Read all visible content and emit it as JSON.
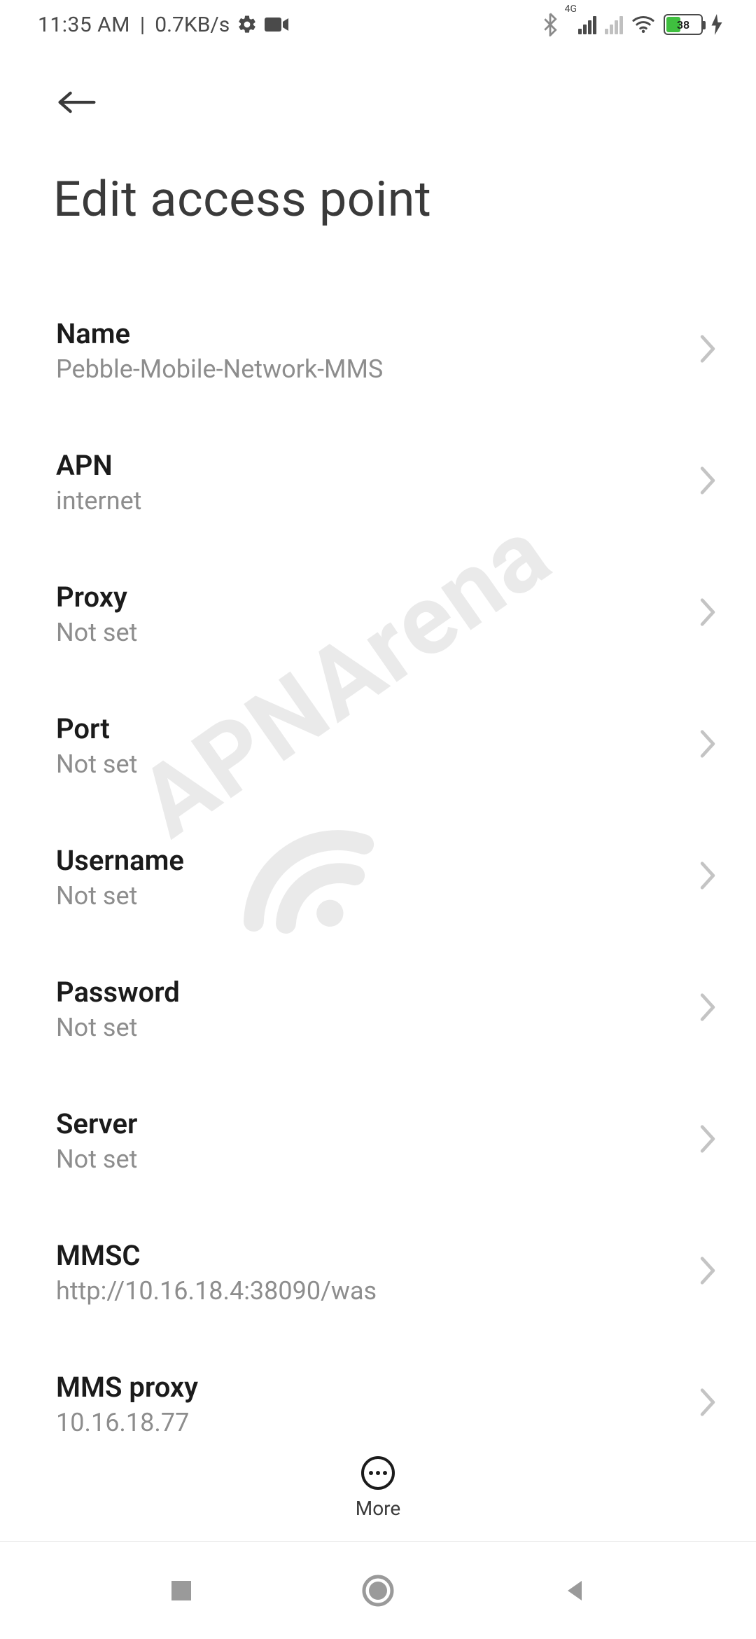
{
  "status": {
    "time": "11:35 AM",
    "net_rate": "0.7KB/s",
    "network_label": "4G",
    "battery_pct": "38"
  },
  "page": {
    "title": "Edit access point"
  },
  "settings": {
    "name": {
      "label": "Name",
      "value": "Pebble-Mobile-Network-MMS"
    },
    "apn": {
      "label": "APN",
      "value": "internet"
    },
    "proxy": {
      "label": "Proxy",
      "value": "Not set"
    },
    "port": {
      "label": "Port",
      "value": "Not set"
    },
    "username": {
      "label": "Username",
      "value": "Not set"
    },
    "password": {
      "label": "Password",
      "value": "Not set"
    },
    "server": {
      "label": "Server",
      "value": "Not set"
    },
    "mmsc": {
      "label": "MMSC",
      "value": "http://10.16.18.4:38090/was"
    },
    "mms_proxy": {
      "label": "MMS proxy",
      "value": "10.16.18.77"
    }
  },
  "footer": {
    "more_label": "More"
  },
  "watermark": {
    "text": "APNArena"
  }
}
